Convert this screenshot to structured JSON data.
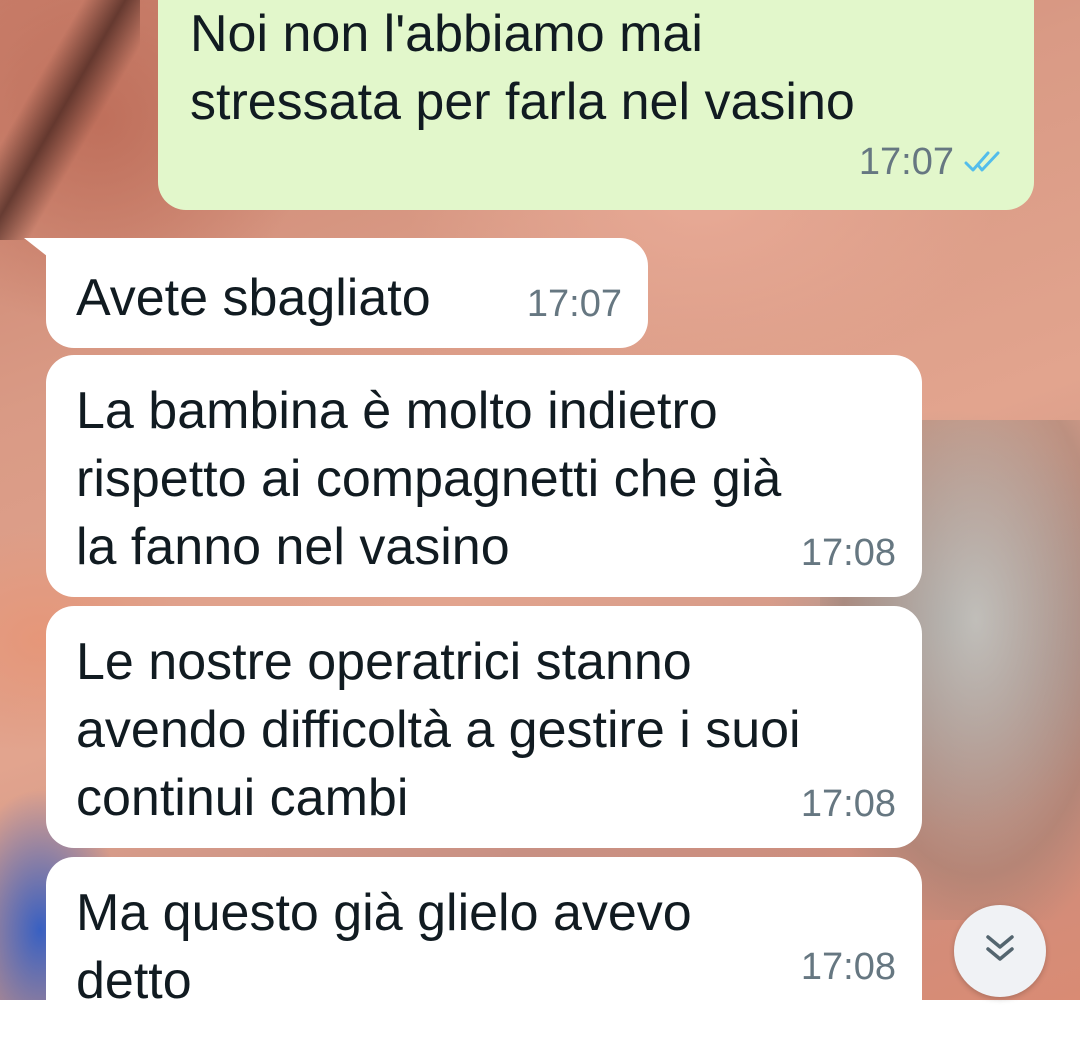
{
  "messages": [
    {
      "direction": "outgoing",
      "text": "Noi non l'abbiamo mai\nstressata per farla nel vasino",
      "time": "17:07",
      "status_icon": "double-check-read-icon"
    },
    {
      "direction": "incoming",
      "text": "Avete sbagliato",
      "time": "17:07"
    },
    {
      "direction": "incoming",
      "text": "La bambina è molto indietro\nrispetto ai compagnetti che già\nla fanno nel vasino",
      "time": "17:08"
    },
    {
      "direction": "incoming",
      "text": "Le nostre operatrici stanno\navendo difficoltà a gestire i suoi\ncontinui cambi",
      "time": "17:08"
    },
    {
      "direction": "incoming",
      "text": "Ma questo già glielo avevo\ndetto",
      "time": "17:08"
    }
  ],
  "scroll_button": {
    "icon": "double-chevron-down-icon"
  },
  "colors": {
    "outgoing_bubble": "#e2f7cb",
    "incoming_bubble": "#ffffff",
    "read_tick": "#53bdeb",
    "timestamp": "#667781",
    "text": "#111b21"
  }
}
